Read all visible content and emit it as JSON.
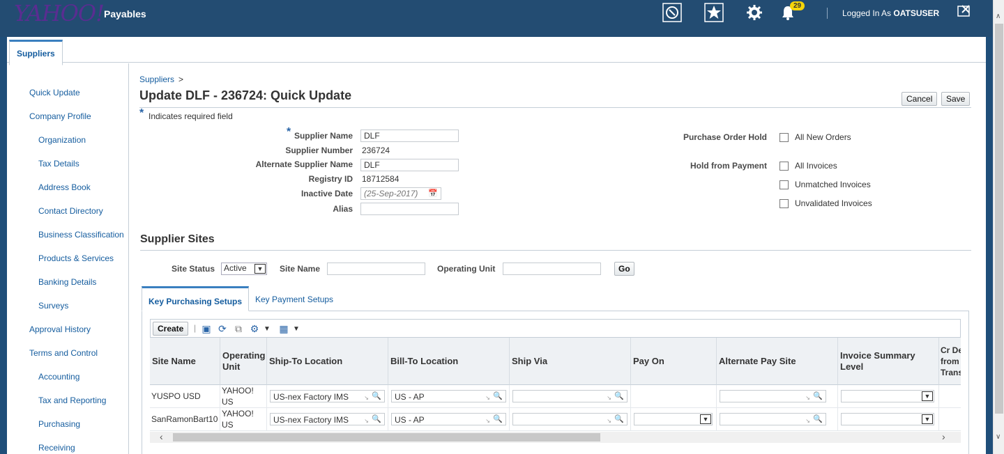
{
  "header": {
    "logo": "YAHOO!",
    "app_name": "Payables",
    "notifications_count": "29",
    "logged_in_prefix": "Logged In As",
    "user": "OATSUSER"
  },
  "top_tabs": [
    {
      "label": "Suppliers"
    }
  ],
  "left_nav": [
    {
      "label": "Quick Update"
    },
    {
      "label": "Company Profile"
    },
    {
      "label": "Organization"
    },
    {
      "label": "Tax Details"
    },
    {
      "label": "Address Book"
    },
    {
      "label": "Contact Directory"
    },
    {
      "label": "Business Classification"
    },
    {
      "label": "Products & Services"
    },
    {
      "label": "Banking Details"
    },
    {
      "label": "Surveys"
    },
    {
      "label": "Approval History"
    },
    {
      "label": "Terms and Control"
    },
    {
      "label": "Accounting"
    },
    {
      "label": "Tax and Reporting"
    },
    {
      "label": "Purchasing"
    },
    {
      "label": "Receiving"
    }
  ],
  "breadcrumb": {
    "root": "Suppliers",
    "sep": ">"
  },
  "page": {
    "title": "Update DLF - 236724: Quick Update",
    "cancel_label": "Cancel",
    "save_label": "Save",
    "required_note": "Indicates required field",
    "required_star": "*"
  },
  "form": {
    "supplier_name_label": "Supplier Name",
    "supplier_name": "DLF",
    "supplier_number_label": "Supplier Number",
    "supplier_number": "236724",
    "alt_supplier_name_label": "Alternate Supplier Name",
    "alt_supplier_name": "DLF",
    "registry_id_label": "Registry ID",
    "registry_id": "18712584",
    "inactive_date_label": "Inactive Date",
    "inactive_date_placeholder": "(25-Sep-2017)",
    "alias_label": "Alias",
    "alias": ""
  },
  "holds": {
    "po_hold_label": "Purchase Order Hold",
    "all_new_orders": "All New Orders",
    "hold_payment_label": "Hold from Payment",
    "all_invoices": "All Invoices",
    "unmatched_invoices": "Unmatched Invoices",
    "unvalidated_invoices": "Unvalidated Invoices"
  },
  "sites": {
    "title": "Supplier Sites",
    "site_status_label": "Site Status",
    "site_status_value": "Active",
    "site_name_label": "Site Name",
    "operating_unit_label": "Operating Unit",
    "go_label": "Go"
  },
  "sub_tabs": [
    {
      "label": "Key Purchasing Setups",
      "active": true
    },
    {
      "label": "Key Payment Setups",
      "active": false
    }
  ],
  "toolbar": {
    "create_label": "Create"
  },
  "table": {
    "columns": [
      "Site Name",
      "Operating Unit",
      "Ship-To Location",
      "Bill-To Location",
      "Ship Via",
      "Pay On",
      "Alternate Pay Site",
      "Invoice Summary Level",
      "Cr Debit from Trans"
    ],
    "rows": [
      {
        "site_name": "YUSPO USD",
        "operating_unit": "YAHOO! US",
        "ship_to": "US-nex Factory IMS",
        "bill_to": "US - AP"
      },
      {
        "site_name": "SanRamonBart10",
        "operating_unit": "YAHOO! US",
        "ship_to": "US-nex Factory IMS",
        "bill_to": "US - AP"
      }
    ]
  }
}
